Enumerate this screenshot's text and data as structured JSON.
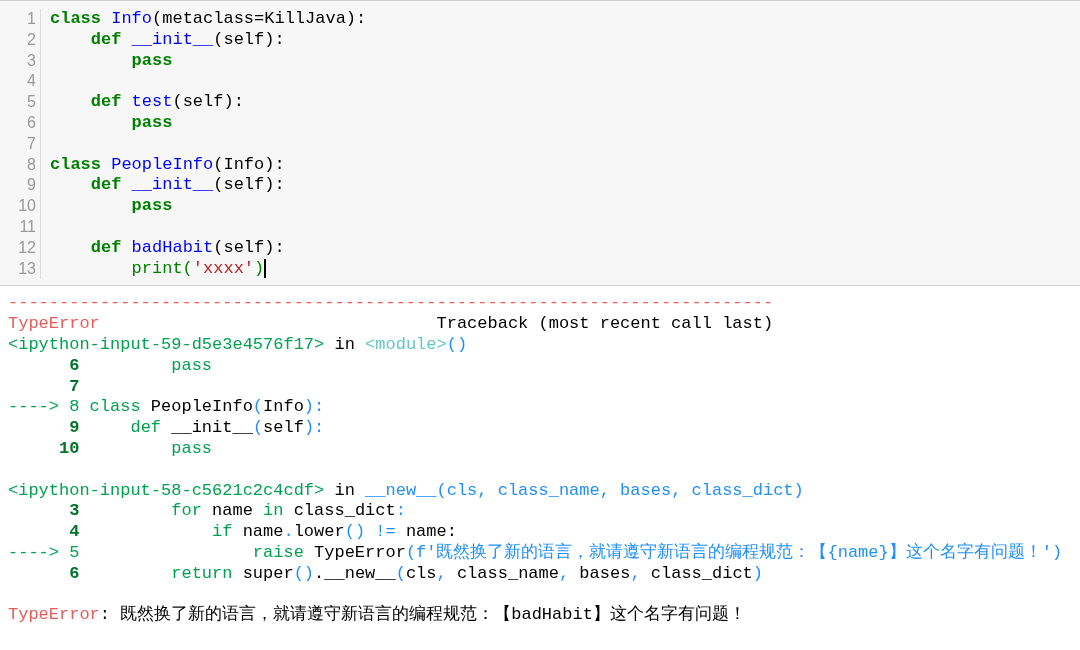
{
  "code_cell": {
    "lines": [
      {
        "number": "1",
        "segments": [
          {
            "kind": "kw",
            "text": "class"
          },
          {
            "kind": "name",
            "text": " Info"
          },
          {
            "kind": "plain",
            "text": "(metaclass=KillJava):"
          }
        ]
      },
      {
        "number": "2",
        "segments": [
          {
            "kind": "kw",
            "text": "    def"
          },
          {
            "kind": "name",
            "text": " __init__"
          },
          {
            "kind": "plain",
            "text": "(self):"
          }
        ]
      },
      {
        "number": "3",
        "segments": [
          {
            "kind": "kw",
            "text": "        pass"
          }
        ]
      },
      {
        "number": "4"
      },
      {
        "number": "5",
        "segments": [
          {
            "kind": "kw",
            "text": "    def"
          },
          {
            "kind": "name",
            "text": " test"
          },
          {
            "kind": "plain",
            "text": "(self):"
          }
        ]
      },
      {
        "number": "6",
        "segments": [
          {
            "kind": "kw",
            "text": "        pass"
          }
        ]
      },
      {
        "number": "7"
      },
      {
        "number": "8",
        "segments": [
          {
            "kind": "kw",
            "text": "class"
          },
          {
            "kind": "name",
            "text": " PeopleInfo"
          },
          {
            "kind": "plain",
            "text": "(Info):"
          }
        ]
      },
      {
        "number": "9",
        "segments": [
          {
            "kind": "kw",
            "text": "    def"
          },
          {
            "kind": "name",
            "text": " __init__"
          },
          {
            "kind": "plain",
            "text": "(self):"
          }
        ]
      },
      {
        "number": "10",
        "segments": [
          {
            "kind": "kw",
            "text": "        pass"
          }
        ]
      },
      {
        "number": "11"
      },
      {
        "number": "12",
        "segments": [
          {
            "kind": "kw",
            "text": "    def"
          },
          {
            "kind": "name",
            "text": " badHabit"
          },
          {
            "kind": "plain",
            "text": "(self):"
          }
        ]
      },
      {
        "number": "13",
        "cursor": true,
        "segments": [
          {
            "kind": "builtin",
            "text": "        print("
          },
          {
            "kind": "str",
            "text": "'xxxx'"
          },
          {
            "kind": "builtin",
            "text": ")"
          }
        ]
      }
    ]
  },
  "traceback": {
    "lines": [
      {
        "kind": "text",
        "segments": [
          {
            "kind": "red",
            "text": "---------------------------------------------------------------------------"
          }
        ]
      },
      {
        "kind": "text",
        "segments": [
          {
            "kind": "red",
            "text": "TypeError"
          },
          {
            "kind": "plain",
            "text": "                                 Traceback (most recent call last)"
          }
        ]
      },
      {
        "kind": "text",
        "segments": [
          {
            "kind": "green",
            "text": "<ipython-input-59-d5e3e4576f17>"
          },
          {
            "kind": "plain",
            "text": " in "
          },
          {
            "kind": "cyan",
            "text": "<module>"
          },
          {
            "kind": "blue",
            "text": "()"
          }
        ]
      },
      {
        "kind": "text",
        "segments": [
          {
            "kind": "lineno",
            "text": "      6"
          },
          {
            "kind": "green",
            "text": "         pass"
          }
        ]
      },
      {
        "kind": "text",
        "segments": [
          {
            "kind": "lineno",
            "text": "      7"
          }
        ]
      },
      {
        "kind": "text",
        "segments": [
          {
            "kind": "green",
            "text": "----> 8 class"
          },
          {
            "kind": "plain",
            "text": " PeopleInfo"
          },
          {
            "kind": "blue",
            "text": "("
          },
          {
            "kind": "plain",
            "text": "Info"
          },
          {
            "kind": "blue",
            "text": "):"
          }
        ]
      },
      {
        "kind": "text",
        "segments": [
          {
            "kind": "lineno",
            "text": "      9"
          },
          {
            "kind": "green",
            "text": "     def"
          },
          {
            "kind": "plain",
            "text": " __init__"
          },
          {
            "kind": "blue",
            "text": "("
          },
          {
            "kind": "plain",
            "text": "self"
          },
          {
            "kind": "blue",
            "text": "):"
          }
        ]
      },
      {
        "kind": "text",
        "segments": [
          {
            "kind": "lineno",
            "text": "     10"
          },
          {
            "kind": "green",
            "text": "         pass"
          }
        ]
      },
      {
        "kind": "blank"
      },
      {
        "kind": "text",
        "segments": [
          {
            "kind": "green",
            "text": "<ipython-input-58-c5621c2c4cdf>"
          },
          {
            "kind": "plain",
            "text": " in "
          },
          {
            "kind": "blue",
            "text": "__new__(cls, class_name, bases, class_dict)"
          }
        ]
      },
      {
        "kind": "text",
        "segments": [
          {
            "kind": "lineno",
            "text": "      3"
          },
          {
            "kind": "green",
            "text": "         for"
          },
          {
            "kind": "plain",
            "text": " name "
          },
          {
            "kind": "green",
            "text": "in"
          },
          {
            "kind": "plain",
            "text": " class_dict"
          },
          {
            "kind": "blue",
            "text": ":"
          }
        ]
      },
      {
        "kind": "text",
        "segments": [
          {
            "kind": "lineno",
            "text": "      4"
          },
          {
            "kind": "green",
            "text": "             if"
          },
          {
            "kind": "plain",
            "text": " name"
          },
          {
            "kind": "blue",
            "text": "."
          },
          {
            "kind": "plain",
            "text": "lower"
          },
          {
            "kind": "blue",
            "text": "() != "
          },
          {
            "kind": "plain",
            "text": "name:"
          }
        ]
      },
      {
        "kind": "text",
        "segments": [
          {
            "kind": "green",
            "text": "----> 5                 raise"
          },
          {
            "kind": "plain",
            "text": " TypeError"
          },
          {
            "kind": "blue",
            "text": "(f'既然换了新的语言，就请遵守新语言的编程规范：【{name}】这个名字有问题！')"
          }
        ]
      },
      {
        "kind": "text",
        "segments": [
          {
            "kind": "lineno",
            "text": "      6"
          },
          {
            "kind": "green",
            "text": "         return"
          },
          {
            "kind": "plain",
            "text": " super"
          },
          {
            "kind": "blue",
            "text": "()"
          },
          {
            "kind": "plain",
            "text": ".__new__"
          },
          {
            "kind": "blue",
            "text": "("
          },
          {
            "kind": "plain",
            "text": "cls"
          },
          {
            "kind": "blue",
            "text": ", "
          },
          {
            "kind": "plain",
            "text": "class_name"
          },
          {
            "kind": "blue",
            "text": ", "
          },
          {
            "kind": "plain",
            "text": "bases"
          },
          {
            "kind": "blue",
            "text": ", "
          },
          {
            "kind": "plain",
            "text": "class_dict"
          },
          {
            "kind": "blue",
            "text": ")"
          }
        ]
      },
      {
        "kind": "blank"
      },
      {
        "kind": "text",
        "segments": [
          {
            "kind": "red",
            "text": "TypeError"
          },
          {
            "kind": "plain",
            "text": ": 既然换了新的语言，就请遵守新语言的编程规范：【badHabit】这个名字有问题！"
          }
        ]
      }
    ]
  }
}
